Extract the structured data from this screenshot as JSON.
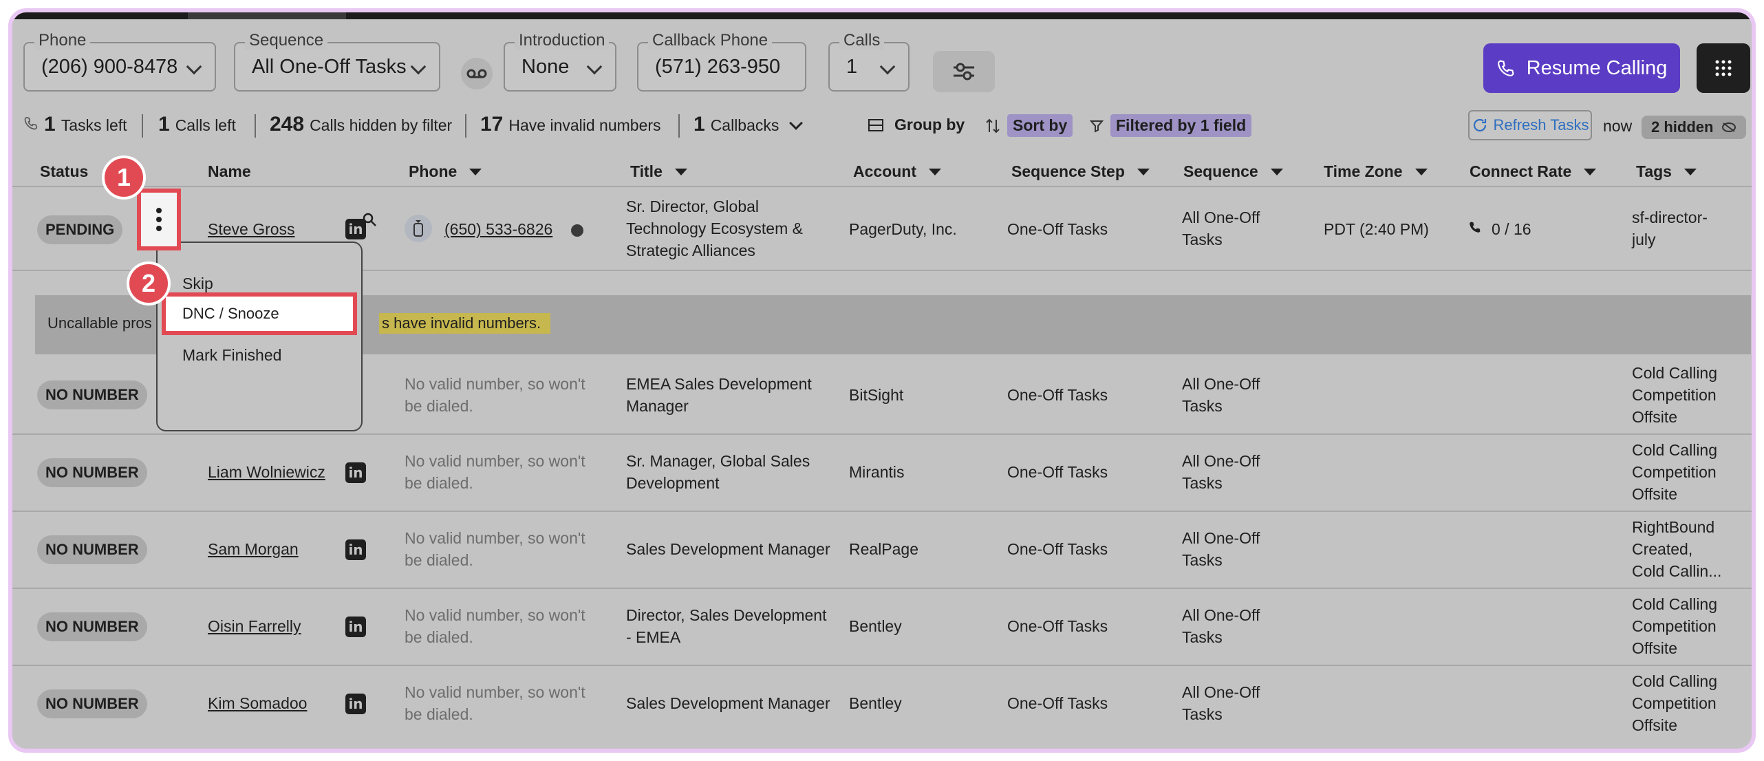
{
  "header": {
    "phone": {
      "label": "Phone",
      "value": "(206) 900-8478"
    },
    "sequence": {
      "label": "Sequence",
      "value": "All One-Off Tasks"
    },
    "introduction": {
      "label": "Introduction",
      "value": "None"
    },
    "callback_phone": {
      "label": "Callback Phone",
      "value": "(571) 263-950"
    },
    "calls": {
      "label": "Calls",
      "value": "1"
    },
    "resume_label": "Resume Calling"
  },
  "stats": {
    "tasks_left": {
      "count": "1",
      "label": "Tasks left"
    },
    "calls_left": {
      "count": "1",
      "label": "Calls left"
    },
    "hidden_by_filter": {
      "count": "248",
      "label": "Calls hidden by filter"
    },
    "invalid_numbers": {
      "count": "17",
      "label": "Have invalid numbers"
    },
    "callbacks": {
      "count": "1",
      "label": "Callbacks"
    },
    "group_by": "Group by",
    "sort_by": "Sort by",
    "filtered": "Filtered by 1 field",
    "refresh": "Refresh Tasks",
    "now": "now",
    "hidden": "2 hidden"
  },
  "table": {
    "headers": {
      "status": "Status",
      "name": "Name",
      "phone": "Phone",
      "title": "Title",
      "account": "Account",
      "step": "Sequence Step",
      "sequence": "Sequence",
      "timezone": "Time Zone",
      "connect": "Connect Rate",
      "tags": "Tags"
    },
    "pending": {
      "status": "PENDING",
      "name": "Steve Gross",
      "phone": "(650) 533-6826",
      "title": [
        "Sr. Director, Global",
        "Technology Ecosystem &",
        "Strategic Alliances"
      ],
      "account": "PagerDuty, Inc.",
      "step": "One-Off Tasks",
      "sequence": [
        "All One-Off",
        "Tasks"
      ],
      "timezone": "PDT (2:40 PM)",
      "connect": "0 / 16",
      "tags": [
        "sf-director-",
        "july"
      ]
    },
    "banner": {
      "text": "Uncallable pros",
      "highlight": "s have invalid numbers."
    },
    "rows": [
      {
        "status": "NO NUMBER",
        "name": "",
        "phone": [
          "No valid number, so won't",
          "be dialed."
        ],
        "title": [
          "EMEA Sales Development",
          "Manager"
        ],
        "account": "BitSight",
        "step": "One-Off Tasks",
        "sequence": [
          "All One-Off",
          "Tasks"
        ],
        "tags": [
          "Cold Calling",
          "Competition",
          "Offsite"
        ]
      },
      {
        "status": "NO NUMBER",
        "name": "Liam Wolniewicz",
        "phone": [
          "No valid number, so won't",
          "be dialed."
        ],
        "title": [
          "Sr. Manager, Global Sales",
          "Development"
        ],
        "account": "Mirantis",
        "step": "One-Off Tasks",
        "sequence": [
          "All One-Off",
          "Tasks"
        ],
        "tags": [
          "Cold Calling",
          "Competition",
          "Offsite"
        ]
      },
      {
        "status": "NO NUMBER",
        "name": "Sam Morgan",
        "phone": [
          "No valid number, so won't",
          "be dialed."
        ],
        "title": [
          "Sales Development Manager"
        ],
        "account": "RealPage",
        "step": "One-Off Tasks",
        "sequence": [
          "All One-Off",
          "Tasks"
        ],
        "tags": [
          "RightBound",
          "Created,",
          "Cold Callin..."
        ]
      },
      {
        "status": "NO NUMBER",
        "name": "Oisin Farrelly",
        "phone": [
          "No valid number, so won't",
          "be dialed."
        ],
        "title": [
          "Director, Sales Development",
          "- EMEA"
        ],
        "account": "Bentley",
        "step": "One-Off Tasks",
        "sequence": [
          "All One-Off",
          "Tasks"
        ],
        "tags": [
          "Cold Calling",
          "Competition",
          "Offsite"
        ]
      },
      {
        "status": "NO NUMBER",
        "name": "Kim Somadoo",
        "phone": [
          "No valid number, so won't",
          "be dialed."
        ],
        "title": [
          "Sales Development Manager"
        ],
        "account": "Bentley",
        "step": "One-Off Tasks",
        "sequence": [
          "All One-Off",
          "Tasks"
        ],
        "tags": [
          "Cold Calling",
          "Competition",
          "Offsite"
        ]
      }
    ]
  },
  "menu": {
    "skip": "Skip",
    "dnc": "DNC / Snooze",
    "finish": "Mark Finished"
  },
  "steps": {
    "one": "1",
    "two": "2"
  },
  "colors": {
    "accent": "#5b3cc4",
    "callout": "#e24a53",
    "highlight": "#c6b74e"
  }
}
